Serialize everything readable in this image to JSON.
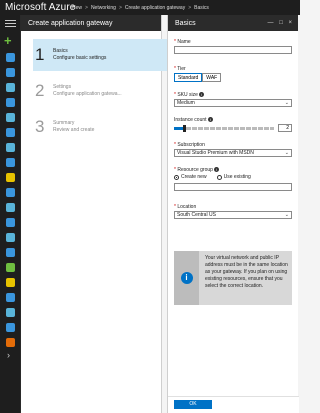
{
  "topbar": {
    "brand": "Microsoft Azure",
    "breadcrumbs": [
      "New",
      "Networking",
      "Create application gateway",
      "Basics"
    ],
    "separator": ">"
  },
  "nav": {
    "menu_icon": "hamburger-icon",
    "new_icon": "plus-icon",
    "expand_icon": "chevron-right-icon",
    "icons": [
      {
        "name": "dashboard-icon",
        "color": "#3a96dd"
      },
      {
        "name": "all-resources-icon",
        "color": "#3a96dd"
      },
      {
        "name": "resource-groups-icon",
        "color": "#59b4d9"
      },
      {
        "name": "app-services-icon",
        "color": "#3a96dd"
      },
      {
        "name": "vms-icon",
        "color": "#59b4d9"
      },
      {
        "name": "sql-icon",
        "color": "#3a96dd"
      },
      {
        "name": "cloud-services-icon",
        "color": "#59b4d9"
      },
      {
        "name": "security-icon",
        "color": "#3a96dd"
      },
      {
        "name": "subscriptions-icon",
        "color": "#e8c300"
      },
      {
        "name": "monitor-icon",
        "color": "#3a96dd"
      },
      {
        "name": "advisor-icon",
        "color": "#59b4d9"
      },
      {
        "name": "storage-icon",
        "color": "#3a96dd"
      },
      {
        "name": "vnet-icon",
        "color": "#59b4d9"
      },
      {
        "name": "aad-icon",
        "color": "#3a96dd"
      },
      {
        "name": "shield-icon",
        "color": "#6fbf40"
      },
      {
        "name": "cost-icon",
        "color": "#e8c300"
      },
      {
        "name": "help-icon",
        "color": "#3a96dd"
      },
      {
        "name": "extensions-icon",
        "color": "#59b4d9"
      },
      {
        "name": "marketplace-icon",
        "color": "#3a96dd"
      },
      {
        "name": "settings-icon",
        "color": "#e36c09"
      }
    ]
  },
  "wizard": {
    "title": "Create application gateway",
    "steps": [
      {
        "number": "1",
        "title": "Basics",
        "subtitle": "Configure basic settings",
        "active": true
      },
      {
        "number": "2",
        "title": "Settings",
        "subtitle": "Configure application gatewa...",
        "active": false
      },
      {
        "number": "3",
        "title": "Summary",
        "subtitle": "Review and create",
        "active": false
      }
    ]
  },
  "basics": {
    "title": "Basics",
    "window_controls": "— □ ×",
    "name": {
      "label": "Name",
      "value": ""
    },
    "tier": {
      "label": "Tier",
      "options": [
        "Standard",
        "WAF"
      ],
      "selected": "Standard"
    },
    "sku": {
      "label": "SKU size",
      "value": "Medium"
    },
    "instance": {
      "label": "Instance count",
      "value": "2",
      "level": 0.1
    },
    "subscription": {
      "label": "Subscription",
      "value": "Visual Studio Premium with MSDN"
    },
    "resource_group": {
      "label": "Resource group",
      "options": [
        "Create new",
        "Use existing"
      ],
      "selected": "Create new",
      "value": ""
    },
    "location": {
      "label": "Location",
      "value": "South Central US"
    },
    "info": "Your virtual network and public IP address must be in the same location as your gateway. If you plan on using existing resources, ensure that you select the correct location.",
    "ok_label": "OK"
  },
  "colors": {
    "accent": "#0072c6",
    "active_step": "#cfe8f6",
    "required": "#cc0000"
  }
}
